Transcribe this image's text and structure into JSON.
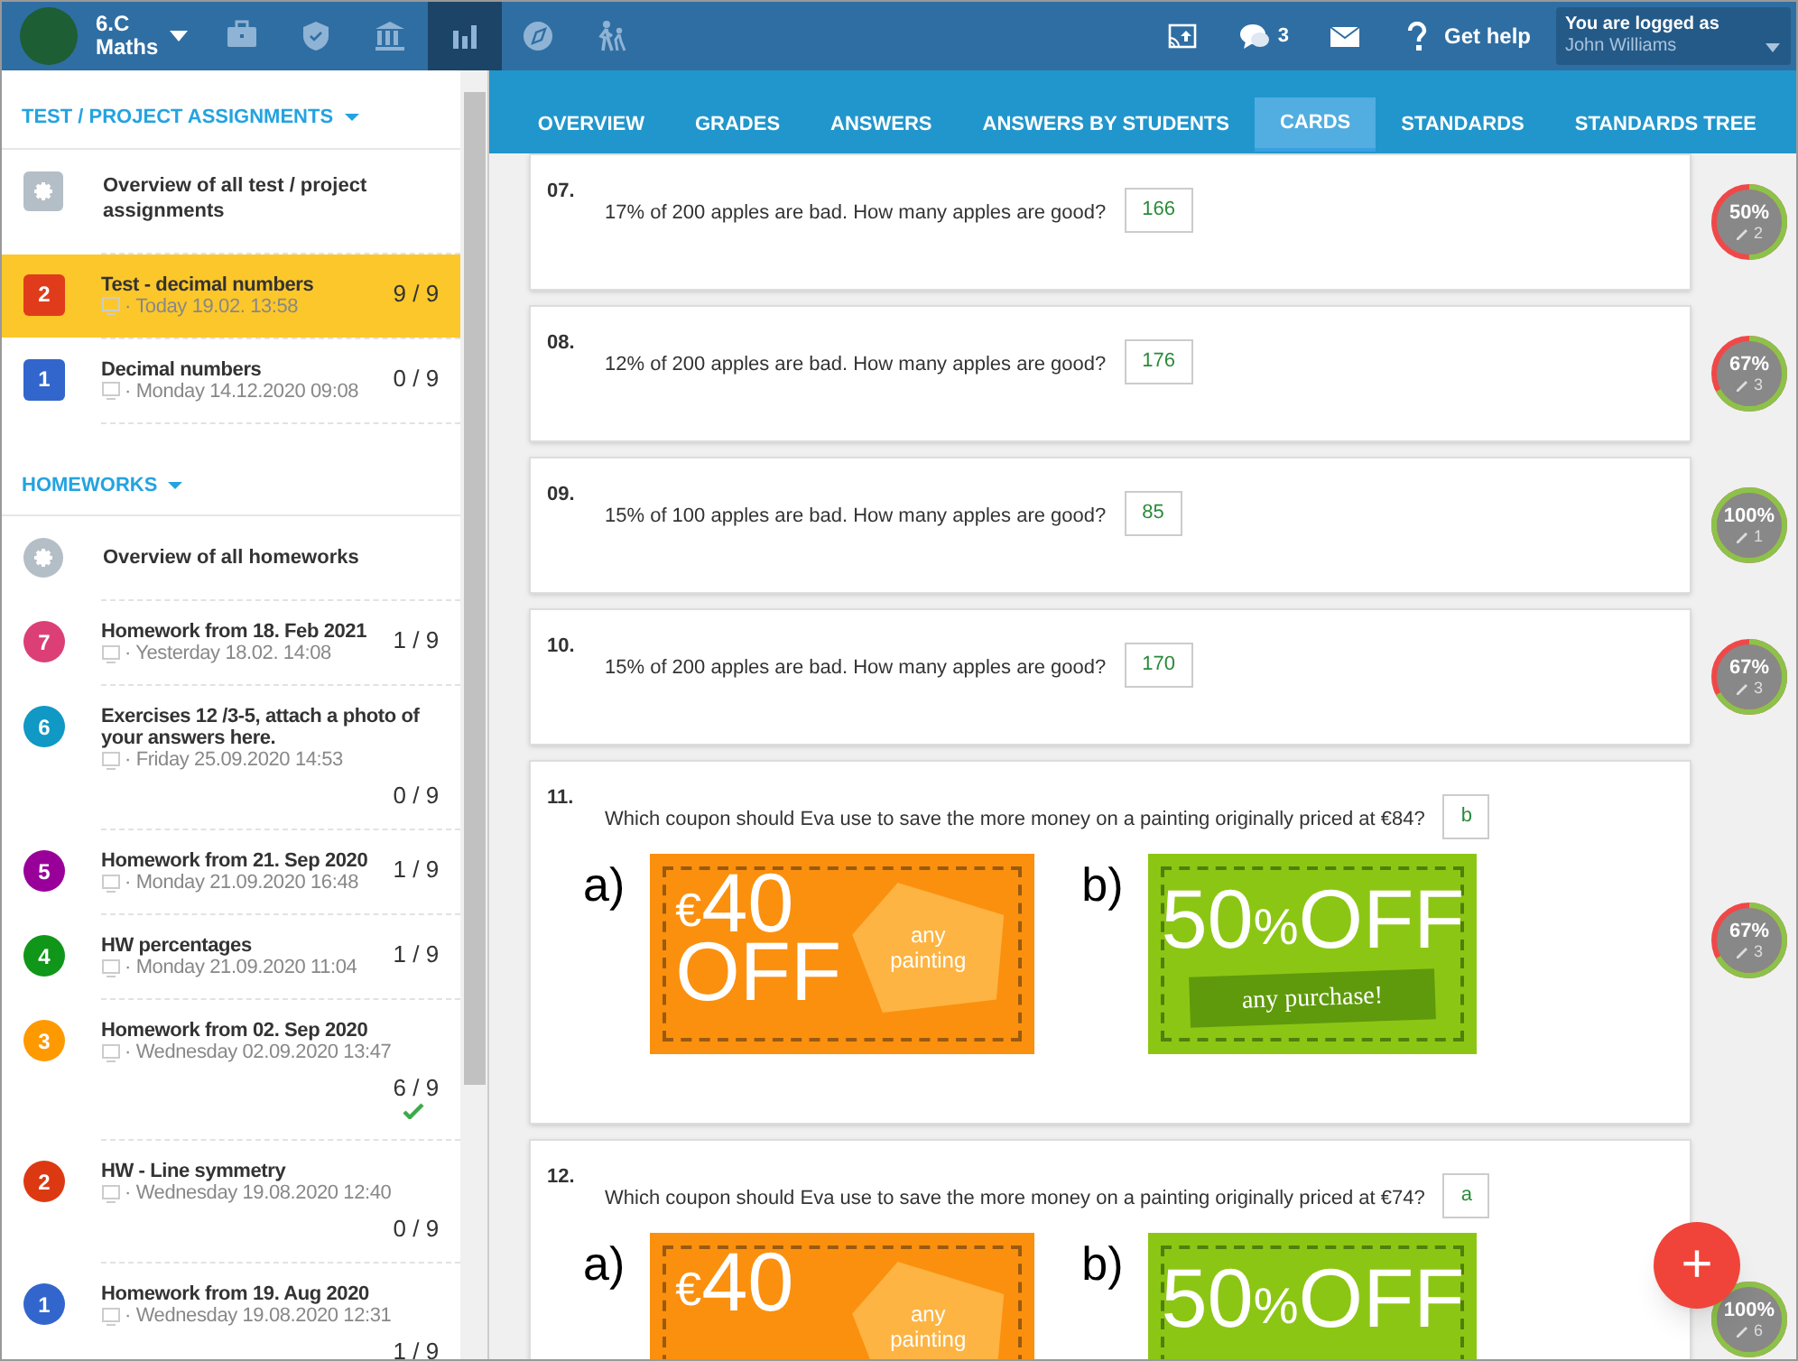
{
  "topbar": {
    "class_name": "6.C",
    "subject": "Maths",
    "nav": [
      {
        "selected": false
      },
      {
        "selected": false
      },
      {
        "selected": false
      },
      {
        "selected": true
      },
      {
        "selected": false
      },
      {
        "selected": false
      }
    ],
    "message_count": "3",
    "help": "Get help",
    "login_label": "You are logged as",
    "user_name": "John Williams"
  },
  "tabs": [
    {
      "label": "OVERVIEW",
      "selected": false
    },
    {
      "label": "GRADES",
      "selected": false
    },
    {
      "label": "ANSWERS",
      "selected": false
    },
    {
      "label": "ANSWERS BY STUDENTS",
      "selected": false
    },
    {
      "label": "CARDS",
      "selected": true
    },
    {
      "label": "STANDARDS",
      "selected": false
    },
    {
      "label": "STANDARDS TREE",
      "selected": false
    }
  ],
  "sections": [
    {
      "title": "TEST / PROJECT ASSIGNMENTS",
      "items": [
        {
          "kind": "overview",
          "title": "Overview of all test / project assignments",
          "selected": false
        },
        {
          "kind": "test",
          "badge": "2",
          "color": "#e03c1c",
          "title": "Test - decimal numbers",
          "date": "· Today 19.02. 13:58",
          "score": "9 / 9",
          "done": false,
          "selected": true
        },
        {
          "kind": "test",
          "badge": "1",
          "color": "#3366cc",
          "title": "Decimal numbers",
          "date": "· Monday 14.12.2020 09:08",
          "score": "0 / 9",
          "done": false,
          "selected": false
        }
      ]
    },
    {
      "title": "HOMEWORKS",
      "items": [
        {
          "kind": "overview",
          "title": "Overview of all homeworks",
          "selected": false
        },
        {
          "kind": "homework",
          "badge": "7",
          "color": "#db3f76",
          "title": "Homework from 18. Feb 2021",
          "date": "· Yesterday 18.02. 14:08",
          "score": "1 / 9",
          "done": false,
          "selected": false
        },
        {
          "kind": "homework",
          "badge": "6",
          "color": "#0f99c4",
          "title": "Exercises 12 /3-5, attach a photo of your answers here.",
          "date": "· Friday 25.09.2020 14:53",
          "score": "0 / 9",
          "done": false,
          "selected": false
        },
        {
          "kind": "homework",
          "badge": "5",
          "color": "#990099",
          "title": "Homework from 21. Sep 2020",
          "date": "· Monday 21.09.2020 16:48",
          "score": "1 / 9",
          "done": false,
          "selected": false
        },
        {
          "kind": "homework",
          "badge": "4",
          "color": "#109618",
          "title": "HW percentages",
          "date": "· Monday 21.09.2020 11:04",
          "score": "1 / 9",
          "done": false,
          "selected": false
        },
        {
          "kind": "homework",
          "badge": "3",
          "color": "#ff9900",
          "title": "Homework from 02. Sep 2020",
          "date": "· Wednesday 02.09.2020 13:47",
          "score": "6 / 9",
          "done": true,
          "selected": false
        },
        {
          "kind": "homework",
          "badge": "2",
          "color": "#dc3912",
          "title": "HW - Line symmetry",
          "date": "· Wednesday 19.08.2020 12:40",
          "score": "0 / 9",
          "done": false,
          "selected": false
        },
        {
          "kind": "homework",
          "badge": "1",
          "color": "#3366cc",
          "title": "Homework from 19. Aug 2020",
          "date": "· Wednesday 19.08.2020 12:31",
          "score": "1 / 9",
          "done": false,
          "selected": false
        }
      ]
    }
  ],
  "questions": [
    {
      "kind": "text",
      "number": "07.",
      "text": "17% of 200 apples are bad. How many apples are good?",
      "answer": "166",
      "percent": "50%",
      "count": "2",
      "level": 0.5
    },
    {
      "kind": "text",
      "number": "08.",
      "text": "12% of 200 apples are bad. How many apples are good?",
      "answer": "176",
      "percent": "67%",
      "count": "3",
      "level": 0.67
    },
    {
      "kind": "text",
      "number": "09.",
      "text": "15% of 100 apples are bad. How many apples are good?",
      "answer": "85",
      "percent": "100%",
      "count": "1",
      "level": 1
    },
    {
      "kind": "text",
      "number": "10.",
      "text": "15% of 200 apples are bad. How many apples are good?",
      "answer": "170",
      "percent": "67%",
      "count": "3",
      "level": 0.67
    },
    {
      "kind": "coupons",
      "number": "11.",
      "text": "Which coupon should Eva use to save the more money on a painting originally priced at €84?",
      "answer": "b",
      "coupons": {
        "a_label": "a)",
        "a_currency": "€",
        "a_amount": "40",
        "a_off": "OFF",
        "a_note": "any painting",
        "b_label": "b)",
        "b_amount": "50",
        "b_percent": "%",
        "b_off": "OFF",
        "b_note": "any purchase!"
      },
      "percent": "67%",
      "count": "3",
      "level": 0.67
    },
    {
      "kind": "coupons",
      "number": "12.",
      "text": "Which coupon should Eva use to save the more money on a painting originally priced at €74?",
      "answer": "a",
      "coupons": {
        "a_label": "a)",
        "a_currency": "€",
        "a_amount": "40",
        "a_note": "any painting",
        "b_label": "b)",
        "b_amount": "50",
        "b_percent": "%",
        "b_off": "OFF"
      },
      "percent": "100%",
      "count": "6",
      "level": 1
    }
  ],
  "fab": "+"
}
